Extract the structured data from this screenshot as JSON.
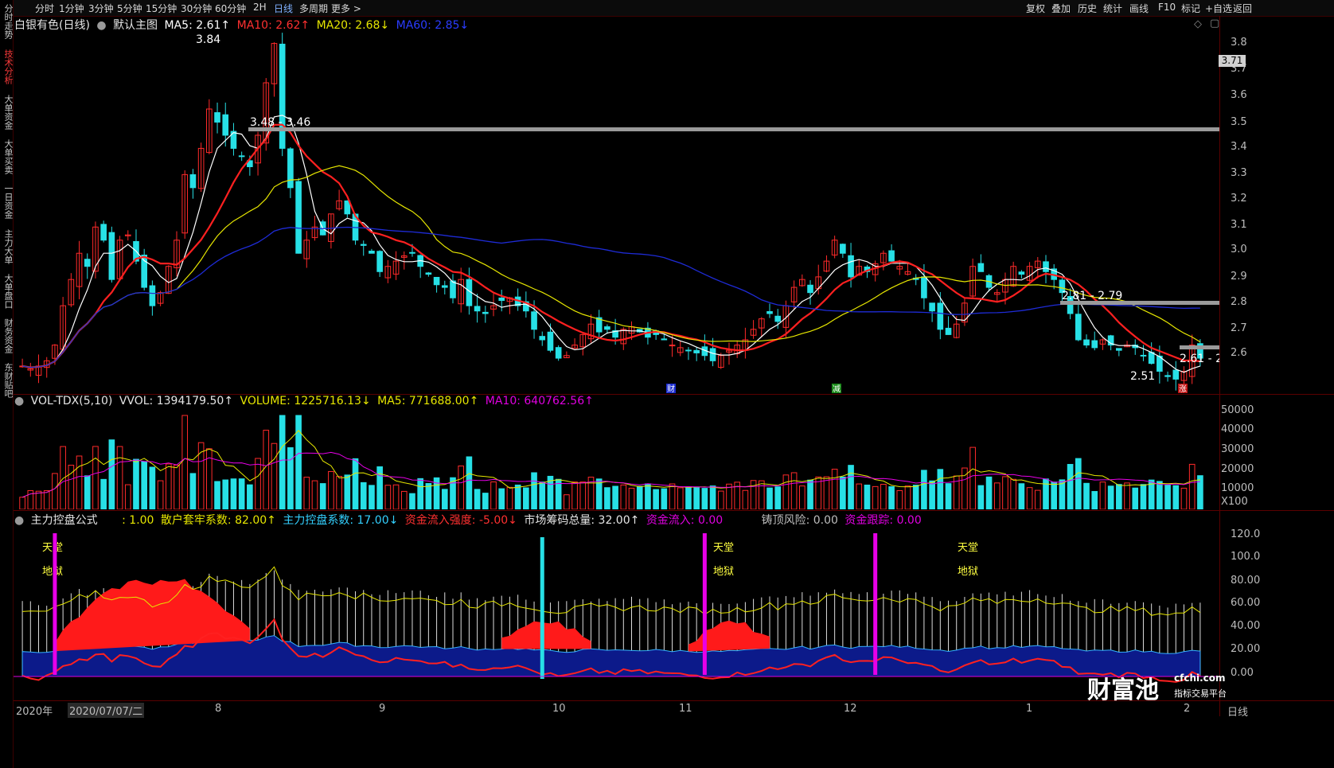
{
  "sidebar": {
    "items": [
      "分时走势",
      "技术分析",
      "大单资金",
      "大单买卖",
      "一日资金",
      "主力大单",
      "大单盘口",
      "财务资金",
      "东财贴吧"
    ]
  },
  "toolbar": {
    "left": [
      "分时",
      "1分钟",
      "3分钟",
      "5分钟",
      "15分钟",
      "30分钟",
      "60分钟",
      "2H",
      "日线",
      "多周期",
      "更多 >"
    ],
    "right": [
      "复权",
      "叠加",
      "历史",
      "统计",
      "画线",
      "F10",
      "标记",
      "+自选",
      "返回"
    ]
  },
  "main_chart": {
    "stock": "白银有色(日线)",
    "template": "默认主图",
    "ma5": "MA5: 2.61↑",
    "ma10": "MA10: 2.62↑",
    "ma20": "MA20: 2.68↓",
    "ma60": "MA60: 2.85↓",
    "price_tag": "3.71",
    "ann_high": "3.84",
    "ann_low": "2.51",
    "zone1": "3.48 - 3.46",
    "zone2": "2.81 - 2.79",
    "zone3": "2.61 - 2",
    "marker_cai": "财",
    "marker_jian": "减",
    "marker_zhang": "涨",
    "yaxis": [
      "3.8",
      "3.7",
      "3.6",
      "3.5",
      "3.4",
      "3.3",
      "3.2",
      "3.1",
      "3.0",
      "2.9",
      "2.8",
      "2.7",
      "2.6"
    ]
  },
  "volume_panel": {
    "title": "VOL-TDX(5,10)",
    "vvol": "VVOL: 1394179.50↑",
    "volume": "VOLUME: 1225716.13↓",
    "ma5": "MA5: 771688.00↑",
    "ma10": "MA10: 640762.56↑",
    "yaxis": [
      "50000",
      "40000",
      "30000",
      "20000",
      "10000",
      "X100"
    ]
  },
  "ind_panel": {
    "title": "主力控盘公式",
    "f1": ": 1.00",
    "f2": "散户套牢系数: 82.00↑",
    "f3": "主力控盘系数: 17.00↓",
    "f4": "资金流入强度: -5.00↓",
    "f5": "市场筹码总量: 32.00↑",
    "f6": "资金流入: 0.00",
    "f7": "铸顶风险: 0.00",
    "f8": "资金跟踪: 0.00",
    "label_tiantang": "天堂",
    "label_diyu": "地狱",
    "yaxis": [
      "120.0",
      "100.0",
      "80.00",
      "60.00",
      "40.00",
      "20.00",
      "0.00"
    ]
  },
  "xaxis": {
    "labels": [
      "2020年",
      "2020/07/07/二",
      "8",
      "9",
      "10",
      "11",
      "12",
      "1",
      "2"
    ],
    "right_label": "日线"
  },
  "watermark": {
    "main": "财富池",
    "site": "cfchi.com",
    "sub": "指标交易平台"
  },
  "colors": {
    "up": "#ff2a2a",
    "down": "#27e0e6",
    "ma5": "#ffffff",
    "ma10": "#ff2020",
    "ma20": "#e6e600",
    "ma60": "#1e2bd6",
    "magenta": "#e800e8"
  },
  "chart_data": {
    "type": "candlestick",
    "price_range": [
      2.51,
      3.84
    ],
    "price_axis_range": [
      2.55,
      3.87
    ],
    "closes": [
      2.62,
      2.61,
      2.62,
      2.64,
      2.7,
      2.85,
      2.95,
      3.05,
      3.0,
      3.15,
      3.1,
      2.95,
      3.1,
      3.12,
      3.02,
      2.92,
      2.85,
      2.9,
      3.0,
      3.1,
      3.35,
      3.3,
      3.45,
      3.6,
      3.55,
      3.5,
      3.45,
      3.42,
      3.38,
      3.5,
      3.7,
      3.85,
      3.45,
      3.3,
      3.05,
      3.1,
      3.15,
      3.12,
      3.2,
      3.25,
      3.2,
      3.1,
      3.08,
      3.05,
      2.98,
      3.0,
      3.02,
      3.04,
      3.05,
      3.0,
      2.97,
      2.93,
      2.92,
      2.88,
      2.95,
      2.85,
      2.83,
      2.82,
      2.85,
      2.87,
      2.88,
      2.85,
      2.83,
      2.76,
      2.72,
      2.68,
      2.65,
      2.66,
      2.7,
      2.74,
      2.78,
      2.75,
      2.76,
      2.73,
      2.76,
      2.77,
      2.75,
      2.73,
      2.74,
      2.72,
      2.7,
      2.69,
      2.68,
      2.67,
      2.66,
      2.64,
      2.66,
      2.68,
      2.7,
      2.72,
      2.76,
      2.8,
      2.82,
      2.79,
      2.85,
      2.92,
      2.95,
      2.9,
      2.96,
      3.02,
      3.1,
      3.05,
      2.96,
      3.0,
      2.98,
      3.01,
      3.05,
      3.02,
      3.0,
      2.98,
      2.95,
      2.88,
      2.83,
      2.76,
      2.74,
      2.78,
      2.86,
      3.0,
      2.98,
      2.92,
      2.9,
      2.95,
      3.0,
      2.97,
      3.0,
      3.02,
      2.98,
      2.95,
      2.9,
      2.82,
      2.72,
      2.7,
      2.69,
      2.72,
      2.7,
      2.68,
      2.7,
      2.69,
      2.66,
      2.63,
      2.6,
      2.58,
      2.57,
      2.6,
      2.7,
      2.65
    ]
  }
}
